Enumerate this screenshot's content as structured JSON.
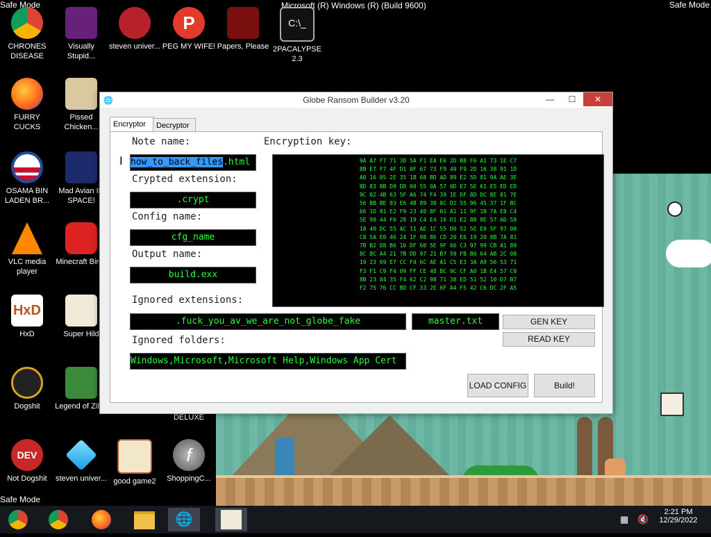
{
  "os": {
    "safe_mode_label": "Safe Mode",
    "build_text": "Microsoft (R) Windows (R) (Build 9600)"
  },
  "desktop_icons": [
    {
      "label": "CHRONES DISEASE",
      "icon": "chrome-icon"
    },
    {
      "label": "Visually Stupid...",
      "icon": "visual-studio-icon"
    },
    {
      "label": "steven univer...",
      "icon": "steven-universe-icon"
    },
    {
      "label": "PEG MY WIFE!",
      "icon": "peggle-icon"
    },
    {
      "label": "Papers, Please",
      "icon": "papers-please-icon"
    },
    {
      "label": "2PACALYPSE 2.3",
      "icon": "cmd-icon"
    },
    {
      "label": "FURRY CUCKS",
      "icon": "firefox-icon"
    },
    {
      "label": "Pissed Chicken...",
      "icon": "pissed-chicken-icon"
    },
    {
      "label": "OSAMA BIN LADEN BR...",
      "icon": "obama-logo-icon"
    },
    {
      "label": "Mad Avian IN SPACE!",
      "icon": "angry-birds-space-icon"
    },
    {
      "label": "VLC media player",
      "icon": "vlc-icon"
    },
    {
      "label": "Minecraft Birds",
      "icon": "angry-birds-icon"
    },
    {
      "label": "HxD",
      "icon": "hxd-icon"
    },
    {
      "label": "Super Hild",
      "icon": "super-hild-icon"
    },
    {
      "label": "Dogshit",
      "icon": "dogshit-icon"
    },
    {
      "label": "Legend of Zilda",
      "icon": "zelda-icon"
    },
    {
      "label": "DELUXE",
      "icon": "deluxe-icon"
    },
    {
      "label": "Not Dogshit",
      "icon": "devcpp-icon"
    },
    {
      "label": "steven univer...",
      "icon": "diamond-icon"
    },
    {
      "label": "good game2",
      "icon": "good-game-icon"
    },
    {
      "label": "ShoppingC...",
      "icon": "flash-icon"
    }
  ],
  "window": {
    "title": "Globe Ransom Builder v3.20",
    "minimize": "—",
    "maximize": "☐",
    "close": "✕",
    "tabs": [
      {
        "label": "Encryptor"
      },
      {
        "label": "Decryptor"
      }
    ],
    "note_name_label": "Note name:",
    "note_name_selected": "how_to_back_files",
    "note_name_rest": ".html",
    "crypted_ext_label": "Crypted extension:",
    "crypted_ext_value": ".crypt",
    "config_name_label": "Config name:",
    "config_name_value": "cfg_name",
    "output_name_label": "Output name:",
    "output_name_value": "build.exx",
    "encryption_key_label": "Encryption key:",
    "encryption_key_lines": [
      "9A A7 F7 71 3D 5A F1 EA E6 2D B8 F6 A1 73 1E C7",
      "8B E7 F7 4F D1 0F 67 73 F9 49 F9 2D 16 38 91 1D",
      "A0 16 05 2E 35 1B 68 BD AD 89 E2 5D 81 9A AE 3E",
      "BD 83 BB D9 DD 00 55 0A 57 0D E7 5E 61 E5 ED ED",
      "9C 02 4B 63 5F A6 74 F4 39 1E DF 8D DC 8E 81 7E",
      "56 BB BE 93 E6 4B 89 38 8C D2 55 96 45 37 1F BC",
      "66 1D 81 E2 F9 23 40 8F 01 A1 11 9F 1B 7A E8 C4",
      "5E 98 44 F0 28 19 C4 E4 16 D1 E2 8B 8E 57 6D 58",
      "18 40 DC 55 AC 11 AE 1C 55 D0 52 5E E0 5F 97 00",
      "C8 5A E0 46 24 1F 98 86 CD 20 E6 19 20 8B 7A 81",
      "7B B2 D8 B6 16 DF 60 5E 9F 66 C3 97 99 CB A1 89",
      "8C 8C A4 21 7B DD 97 21 B7 59 FB B0 64 AB 2C 08",
      "19 23 69 E7 CC F4 6C AE A1 C5 E3 3A A9 56 53 71",
      "F3 F1 C9 F4 09 FF CE 48 BC 0C CF A0 1B E4 57 C0",
      "8B 23 84 35 F4 62 C2 98 71 38 ED 51 52 10 D7 B7",
      "F2 75 76 CC BD CF 33 2E 6F A4 F5 42 C6 DC 2F A5"
    ],
    "ignored_ext_label": "Ignored extensions:",
    "ignored_ext_value": ".fuck_you_av_we_are_not_globe_fake",
    "master_value": "master.txt",
    "gen_key_button": "GEN KEY",
    "read_key_button": "READ KEY",
    "ignored_folders_label": "Ignored folders:",
    "ignored_folders_value": "Windows,Microsoft,Microsoft Help,Windows App Cert",
    "load_config_button": "LOAD CONFIG",
    "build_button": "Build!"
  },
  "taskbar": {
    "time": "2:21 PM",
    "date": "12/29/2022"
  }
}
